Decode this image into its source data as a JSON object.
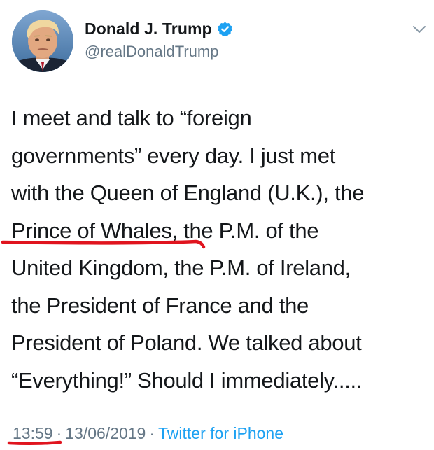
{
  "tweet": {
    "author": {
      "name": "Donald J. Trump",
      "handle": "@realDonaldTrump",
      "verified_icon": "verified-badge-icon"
    },
    "menu_icon": "chevron-down-icon",
    "lines": [
      "I meet and talk to “foreign",
      "governments” every day. I just met",
      "with the Queen of England (U.K.), the",
      "Prince of Whales, the P.M. of the",
      "United Kingdom, the P.M. of Ireland,",
      "the President of France and the",
      "President of Poland. We talked about",
      "“Everything!” Should I immediately....."
    ],
    "time": "13:59",
    "separator": "·",
    "date": "13/06/2019",
    "source": "Twitter for iPhone"
  },
  "colors": {
    "text": "#14171a",
    "secondary": "#657786",
    "link": "#1da1f2",
    "verified": "#1da1f2",
    "annotation_marker": "#e0141e"
  }
}
